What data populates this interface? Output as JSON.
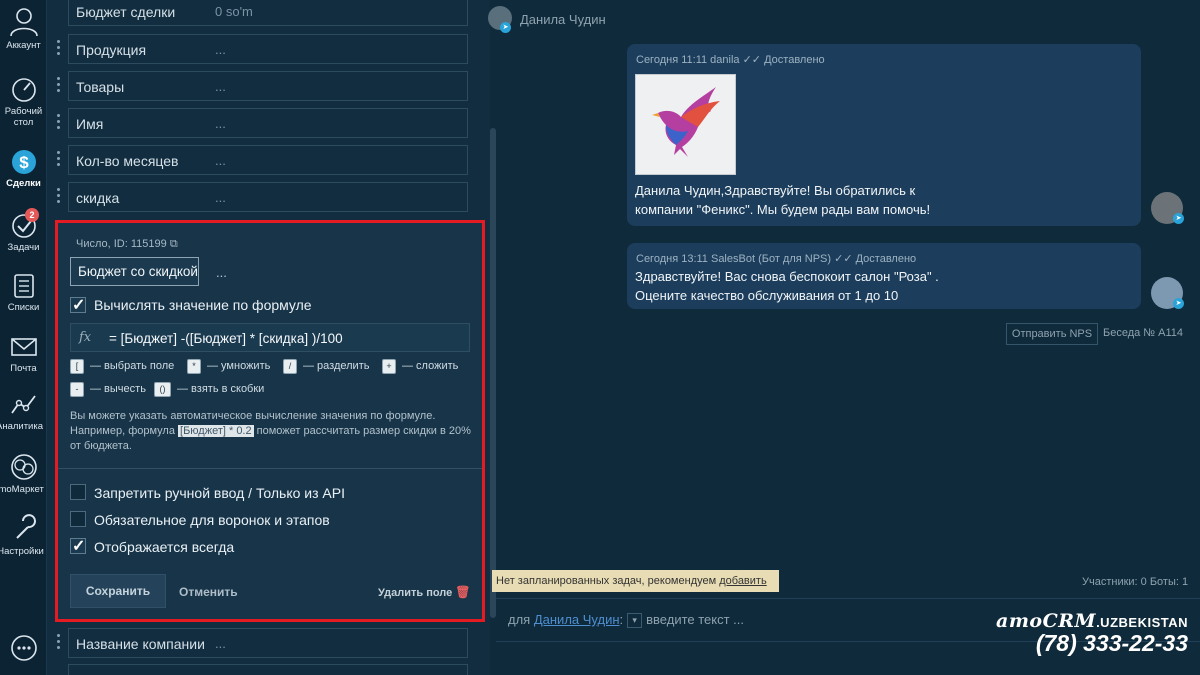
{
  "nav": {
    "account": "Аккаунт",
    "dashboard": "Рабочий стол",
    "deals": "Сделки",
    "tasks": "Задачи",
    "tasks_badge": "2",
    "lists": "Списки",
    "mail": "Почта",
    "analytics": "Аналитика",
    "market": "amoМаркет",
    "settings": "Настройки"
  },
  "fields": [
    {
      "label": "Бюджет сделки",
      "value": "0 so'm"
    },
    {
      "label": "Продукция",
      "value": "..."
    },
    {
      "label": "Товары",
      "value": "..."
    },
    {
      "label": "Имя",
      "value": "..."
    },
    {
      "label": "Кол-во месяцев",
      "value": "..."
    },
    {
      "label": "скидка",
      "value": "..."
    }
  ],
  "editor": {
    "id_line": "Число, ID: 115199",
    "name_value": "Бюджет со скидкой",
    "dots": "...",
    "formula_checkbox": "Вычислять значение по формуле",
    "formula_checked": true,
    "fx": "fx",
    "formula": "= [Бюджет] -([Бюджет] * [скидка] )/100",
    "keys": [
      {
        "key": "[",
        "desc": "— выбрать поле"
      },
      {
        "key": "*",
        "desc": "— умножить"
      },
      {
        "key": "/",
        "desc": "— разделить"
      },
      {
        "key": "+",
        "desc": "— сложить"
      },
      {
        "key": "-",
        "desc": "— вычесть"
      },
      {
        "key": "()",
        "desc": "— взять в скобки"
      }
    ],
    "hint_1": "Вы можете указать автоматическое вычисление значения по формуле. Например, формула ",
    "hint_code": "[Бюджет] * 0.2",
    "hint_2": " поможет рассчитать размер скидки в 20% от бюджета.",
    "option_1": "Запретить ручной ввод / Только из API",
    "option_2": "Обязательное для воронок и этапов",
    "option_3": "Отображается всегда",
    "option_1_checked": false,
    "option_2_checked": false,
    "option_3_checked": true,
    "save": "Сохранить",
    "cancel": "Отменить",
    "delete": "Удалить поле"
  },
  "fields_after": [
    {
      "label": "Название компании",
      "value": "..."
    }
  ],
  "chat": {
    "contact_name": "Данила Чудин",
    "messages": [
      {
        "meta": "Сегодня 11:11 danila",
        "status": "Доставлено",
        "text": "Данила Чудин,Здравствуйте! Вы обратились к компании \"Феникс\". Мы будем рады вам помочь!"
      },
      {
        "meta": "Сегодня 13:11 SalesBot (Бот для NPS)",
        "status": "Доставлено",
        "text": "Здравствуйте! Вас снова беспокоит салон \"Роза\" . Оцените качество обслуживания от 1 до 10"
      }
    ],
    "nps_button": "Отправить NPS",
    "conversation": "Беседа № А114",
    "tasks_notice": "Нет запланированных задач, рекомендуем ",
    "tasks_link": "добавить",
    "participants": "Участники: 0   Боты: 1",
    "input_for": "для",
    "input_contact": "Данила Чудин",
    "input_placeholder": "введите текст ..."
  },
  "brand": {
    "logo": "amoCRM",
    "suffix": ".UZBEKISTAN",
    "phone": "(78) 333-22-33"
  }
}
